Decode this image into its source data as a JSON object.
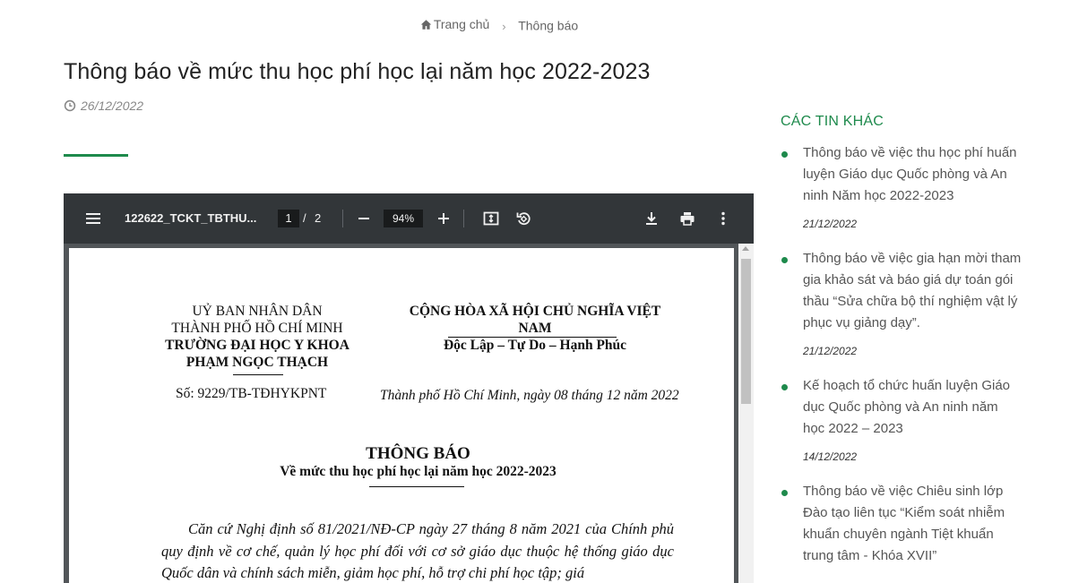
{
  "breadcrumb": {
    "home_label": "Trang chủ",
    "current_label": "Thông báo"
  },
  "article": {
    "title": "Thông báo về mức thu học phí học lại năm học 2022-2023",
    "date": "26/12/2022"
  },
  "pdf_viewer": {
    "file_name": "122622_TCKT_TBTHU...",
    "current_page": "1",
    "page_separator": "/",
    "total_pages": "2",
    "zoom": "94%",
    "icons": [
      "menu-icon",
      "zoom-out-icon",
      "zoom-in-icon",
      "fit-page-icon",
      "rotate-icon",
      "download-icon",
      "print-icon",
      "more-icon"
    ]
  },
  "document": {
    "left_header": {
      "line1": "UỶ BAN NHÂN DÂN",
      "line2": "THÀNH PHỐ HỒ CHÍ MINH",
      "line3": "TRƯỜNG ĐẠI HỌC Y KHOA",
      "line4": "PHẠM NGỌC THẠCH"
    },
    "right_header": {
      "line1": "CỘNG HÒA XÃ HỘI CHỦ NGHĨA VIỆT NAM",
      "line2": "Độc Lập – Tự Do – Hạnh Phúc"
    },
    "number": "Số: 9229/TB-TĐHYKPNT",
    "place_date": "Thành phố Hồ Chí Minh, ngày 08 tháng 12 năm 2022",
    "heading": "THÔNG BÁO",
    "subheading": "Về mức thu học phí học lại năm học  2022-2023",
    "body": "Căn cứ Nghị định số 81/2021/NĐ-CP ngày 27 tháng 8 năm 2021 của Chính phủ quy định về cơ chế, quản lý học phí đối với cơ sở giáo dục thuộc hệ thống giáo dục Quốc dân và chính sách miễn, giảm học phí, hỗ trợ chi phí học tập; giá"
  },
  "sidebar": {
    "title": "CÁC TIN KHÁC",
    "items": [
      {
        "title": "Thông báo về việc thu học phí huấn luyện Giáo dục Quốc phòng và An ninh Năm học 2022-2023",
        "date": "21/12/2022"
      },
      {
        "title": "Thông báo về việc gia hạn mời tham gia khảo sát và báo giá dự toán gói thầu “Sửa chữa bộ thí nghiệm vật lý phục vụ giảng dạy”.",
        "date": "21/12/2022"
      },
      {
        "title": "Kế hoạch tổ chức huấn luyện Giáo dục Quốc phòng và An ninh năm học 2022 – 2023",
        "date": "14/12/2022"
      },
      {
        "title": "Thông báo về việc Chiêu sinh lớp Đào tạo liên tục “Kiểm soát nhiễm khuẩn chuyên ngành Tiệt khuẩn trung tâm - Khóa XVII”",
        "date": ""
      }
    ]
  },
  "colors": {
    "accent": "#1e8a4c",
    "toolbar": "#323639",
    "viewer_bg": "#525659"
  }
}
